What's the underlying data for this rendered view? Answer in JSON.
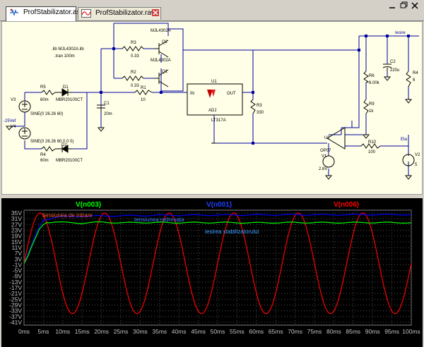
{
  "tabs": [
    {
      "label": "ProfStabilizator.asc",
      "icon": "schematic-icon"
    },
    {
      "label": "ProfStabilizator.raw",
      "icon": "waveform-icon"
    }
  ],
  "schematic": {
    "directives": [
      ".lib MJL4302A.lib",
      ".tran 100m"
    ],
    "net_labels": {
      "out": "Iesire",
      "in": "-25Vef",
      "eta": "Eta"
    },
    "components": {
      "r3": {
        "name": "R3",
        "value": "0.33"
      },
      "r2": {
        "name": "R2",
        "value": "0.33"
      },
      "q2": {
        "name": "Q2",
        "model": "MJL4302A"
      },
      "q1": {
        "name": "Q1",
        "model": "MJL4302A"
      },
      "r5": {
        "name": "R5",
        "value": "60m"
      },
      "r4": {
        "name": "R4",
        "value": "60m"
      },
      "d1": {
        "name": "D1",
        "model": "MBR20100CT"
      },
      "d2": {
        "name": "D2",
        "model": "MBR20100CT"
      },
      "v3": {
        "name": "V3",
        "value": "SINE(0 26.26 60)"
      },
      "v4": {
        "name": "V4",
        "value": "SINE(0 26.26 60 0 0 0)"
      },
      "c1": {
        "name": "C1",
        "value": "20m"
      },
      "r1": {
        "name": "R1",
        "value": "10"
      },
      "u1": {
        "name": "U1",
        "model": "LT317A",
        "pin_in": "IN",
        "pin_out": "OUT",
        "pin_adj": "ADJ"
      },
      "r3b": {
        "name": "R3",
        "value": "330"
      },
      "r6": {
        "name": "R6",
        "value": "8.00k"
      },
      "r9": {
        "name": "R9",
        "value": "1k"
      },
      "c2": {
        "name": "C2",
        "value": "220u"
      },
      "r4b": {
        "name": "R4",
        "value": "6"
      },
      "u2": {
        "name": "U2",
        "model": "OP07"
      },
      "v1": {
        "name": "V1",
        "value": "2.6V"
      },
      "r10": {
        "name": "R10",
        "value": "100"
      },
      "v2": {
        "name": "V2",
        "value": "5"
      }
    }
  },
  "waveform": {
    "traces": [
      {
        "name": "V(n003)",
        "color": "#00ff00"
      },
      {
        "name": "V(n001)",
        "color": "#0000ff"
      },
      {
        "name": "V(n006)",
        "color": "#ff0000"
      }
    ],
    "annotations": [
      {
        "text": "tensiunea de intrare",
        "color": "#ff6030"
      },
      {
        "text": "tensiunea redresata",
        "color": "#4080ff"
      },
      {
        "text": "iesirea stabilizatorului",
        "color": "#40a0ff"
      }
    ],
    "y_labels": [
      "35V",
      "31V",
      "27V",
      "23V",
      "19V",
      "15V",
      "11V",
      "7V",
      "3V",
      "-1V",
      "-5V",
      "-9V",
      "-13V",
      "-17V",
      "-21V",
      "-25V",
      "-29V",
      "-33V",
      "-37V",
      "-41V"
    ],
    "x_labels": [
      "0ms",
      "5ms",
      "10ms",
      "15ms",
      "20ms",
      "25ms",
      "30ms",
      "35ms",
      "40ms",
      "45ms",
      "50ms",
      "55ms",
      "60ms",
      "65ms",
      "70ms",
      "75ms",
      "80ms",
      "85ms",
      "90ms",
      "95ms",
      "100ms"
    ]
  },
  "chart_data": {
    "type": "line",
    "xlim": [
      0,
      100
    ],
    "ylim": [
      -43,
      37
    ],
    "grid": true,
    "series": [
      {
        "name": "V(n006)",
        "color": "#ff0000",
        "amplitude": 35,
        "freq_hz": 60,
        "x": [
          0,
          4.17,
          8.33,
          12.5,
          16.67,
          20.83,
          25,
          29.17,
          33.33,
          37.5,
          41.67,
          45.83,
          50,
          54.17,
          58.33,
          62.5,
          66.67,
          70.83,
          75,
          79.17,
          83.33,
          87.5,
          91.67,
          95.83,
          100
        ],
        "values": [
          0,
          35,
          0,
          -35,
          0,
          35,
          0,
          -35,
          0,
          35,
          0,
          -35,
          0,
          35,
          0,
          -35,
          0,
          35,
          0,
          -35,
          0,
          35,
          0,
          -35,
          -20.6
        ]
      },
      {
        "name": "V(n001)",
        "color": "#0000ff",
        "x": [
          0,
          1,
          2,
          3,
          4,
          5,
          8,
          10,
          20,
          30,
          40,
          50,
          60,
          70,
          80,
          90,
          100
        ],
        "values": [
          0,
          6,
          13,
          20,
          26,
          30,
          32,
          32.5,
          33,
          33.3,
          33.5,
          33.6,
          33.7,
          33.8,
          33.8,
          33.9,
          33.9
        ]
      },
      {
        "name": "V(n003)",
        "color": "#00ff00",
        "x": [
          0,
          1,
          2,
          3,
          4,
          5,
          6,
          8,
          10,
          15,
          20,
          25,
          30,
          40,
          50,
          60,
          70,
          80,
          90,
          100
        ],
        "values": [
          0,
          5,
          12,
          18,
          24,
          27,
          28.5,
          28.8,
          28.5,
          28,
          28.7,
          28.2,
          28.4,
          28.3,
          28.4,
          28.2,
          28.4,
          28.3,
          28.4,
          28.3
        ]
      }
    ]
  }
}
